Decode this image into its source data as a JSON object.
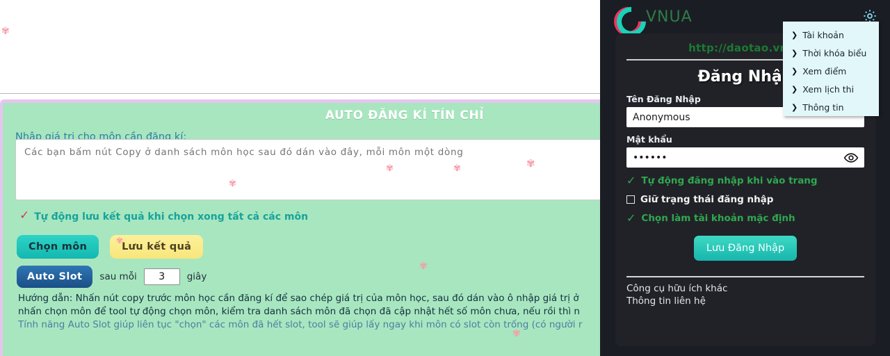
{
  "page": {
    "white_box_placeholder": ""
  },
  "auto_panel": {
    "title": "AUTO ĐĂNG KÍ TÍN CHỈ",
    "field_label": "Nhập giá trị cho môn cần đăng kí:",
    "textarea_placeholder": "Các bạn bấm nút Copy ở danh sách môn học sau đó dán vào đây, mỗi môn một dòng",
    "textarea_value": "",
    "autosave_tick": "✓",
    "autosave_label": "Tự động lưu kết quả khi chọn xong tất cả các môn",
    "btn_chon_mon": "Chọn môn",
    "btn_luu_ket_qua": "Lưu kết quả",
    "btn_auto_slot": "Auto Slot",
    "interval_prefix": "sau mỗi",
    "interval_value": "3",
    "interval_suffix": "giây",
    "guide_line_1": "Hướng dẫn: Nhấn nút copy trước môn học cần đăng kí để sao chép giá trị của môn học, sau đó dán vào ô nhập giá trị ở",
    "guide_line_2": "nhấn chọn môn để tool tự động chọn môn, kiểm tra danh sách môn đã chọn đã cập nhật hết số môn chưa, nếu rồi thì n",
    "guide_line_3": "Tính năng Auto Slot giúp liên tục \"chọn\" các môn đã hết slot, tool sẽ giúp lấy ngay khi môn có slot còn trống (có người r"
  },
  "extension": {
    "brand": "VNUA",
    "logo_icon": "letter-c-glitch-logo",
    "gear_icon": "gear-icon",
    "site_url": "http://daotao.vnua",
    "login_title": "Đăng Nhập",
    "username_label": "Tên Đăng Nhập",
    "username_value": "Anonymous",
    "password_label": "Mật khẩu",
    "password_value": "••••••",
    "eye_icon": "eye-icon",
    "options": [
      {
        "icon": "check-icon",
        "label": "Tự động đăng nhập khi vào trang",
        "checked": true,
        "style": "green"
      },
      {
        "icon": "checkbox-empty-icon",
        "label": "Giữ trạng thái đăng nhập",
        "checked": false,
        "style": "white"
      },
      {
        "icon": "check-icon",
        "label": "Chọn làm tài khoản mặc định",
        "checked": true,
        "style": "green"
      }
    ],
    "save_button": "Lưu Đăng Nhập",
    "footer_links": [
      "Công cụ hữu ích khác",
      "Thông tin liên hệ"
    ]
  },
  "gear_menu": {
    "chevron": "❯",
    "items": [
      {
        "label": "Tài khoản"
      },
      {
        "label": "Thời khóa biểu"
      },
      {
        "label": "Xem điểm"
      },
      {
        "label": "Xem lịch thi"
      },
      {
        "label": "Thông tin"
      }
    ]
  },
  "decorations": {
    "flower_glyph": "✾"
  },
  "colors": {
    "panel_green": "#a8e6c0",
    "panel_border_purple": "#e6c6f0",
    "ext_background": "#1b1d24",
    "ext_card": "#212228",
    "accent_teal": "#17b6ac",
    "accent_green": "#2fa84f",
    "menu_background": "#e2f7fa",
    "logo_pink": "#f4325f",
    "logo_teal": "#17d3b8",
    "brand_green": "#2e7d46",
    "url_green": "#1c7a33",
    "flower_pink": "#f79aa6"
  }
}
